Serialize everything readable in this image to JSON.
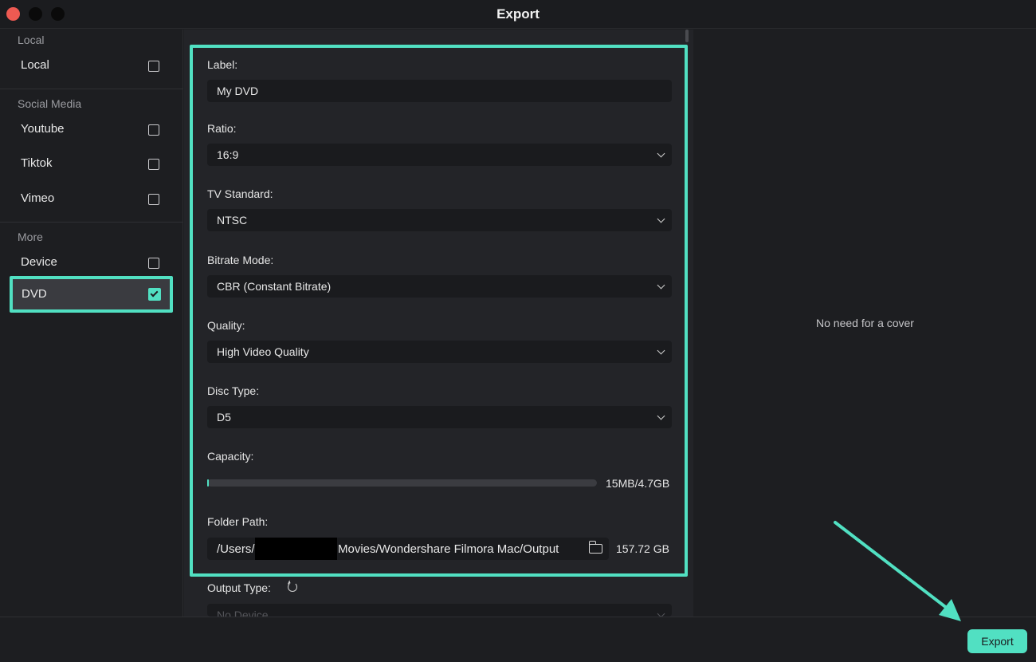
{
  "window": {
    "title": "Export"
  },
  "sidebar": {
    "groups": [
      {
        "title": "Local",
        "items": [
          {
            "label": "Local",
            "checked": false
          }
        ]
      },
      {
        "title": "Social Media",
        "items": [
          {
            "label": "Youtube",
            "checked": false
          },
          {
            "label": "Tiktok",
            "checked": false
          },
          {
            "label": "Vimeo",
            "checked": false
          }
        ]
      },
      {
        "title": "More",
        "items": [
          {
            "label": "Device",
            "checked": false
          },
          {
            "label": "DVD",
            "checked": true
          }
        ]
      }
    ]
  },
  "form": {
    "label": {
      "title": "Label:",
      "value": "My DVD"
    },
    "ratio": {
      "title": "Ratio:",
      "value": "16:9"
    },
    "tv_standard": {
      "title": "TV Standard:",
      "value": "NTSC"
    },
    "bitrate_mode": {
      "title": "Bitrate Mode:",
      "value": "CBR (Constant Bitrate)"
    },
    "quality": {
      "title": "Quality:",
      "value": "High Video Quality"
    },
    "disc_type": {
      "title": "Disc Type:",
      "value": "D5"
    },
    "capacity": {
      "title": "Capacity:",
      "text": "15MB/4.7GB",
      "fraction": 0.003
    },
    "folder_path": {
      "title": "Folder Path:",
      "prefix": "/Users/",
      "suffix": "Movies/Wondershare Filmora Mac/Output",
      "free_space": "157.72 GB"
    },
    "output_type": {
      "title": "Output Type:",
      "value": "No Device"
    }
  },
  "cover": {
    "message": "No need for a cover"
  },
  "footer": {
    "export_label": "Export"
  },
  "colors": {
    "accent": "#51e0c2",
    "close": "#ee5a52"
  }
}
